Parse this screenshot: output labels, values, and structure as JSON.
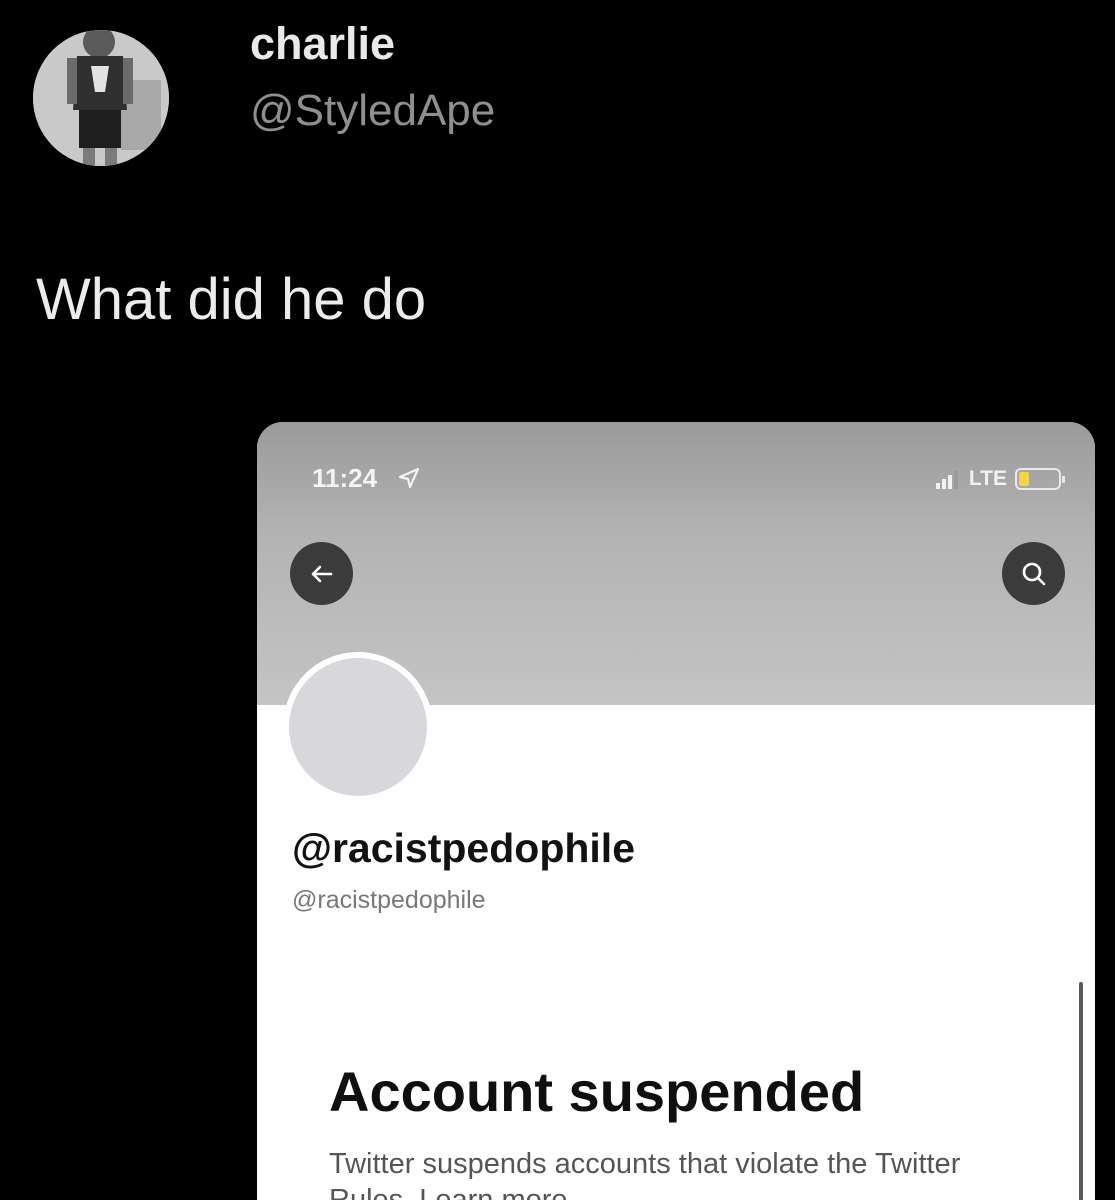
{
  "tweet": {
    "author_name": "charlie",
    "author_handle": "@StyledApe",
    "text": "What did he do"
  },
  "screenshot": {
    "status_bar": {
      "time": "11:24",
      "network": "LTE",
      "battery_level": 0.25,
      "battery_color": "#f4d34a"
    },
    "profile": {
      "display_name": "@racistpedophile",
      "handle": "@racistpedophile"
    },
    "suspension": {
      "title": "Account suspended",
      "body": "Twitter suspends accounts that violate the Twitter Rules. Learn more"
    }
  },
  "colors": {
    "background": "#000000",
    "tweet_text": "#ececec",
    "handle_gray": "#8f8f8f"
  },
  "icons": [
    "location-arrow-icon",
    "signal-bars-icon",
    "battery-icon",
    "back-arrow-icon",
    "search-icon"
  ]
}
